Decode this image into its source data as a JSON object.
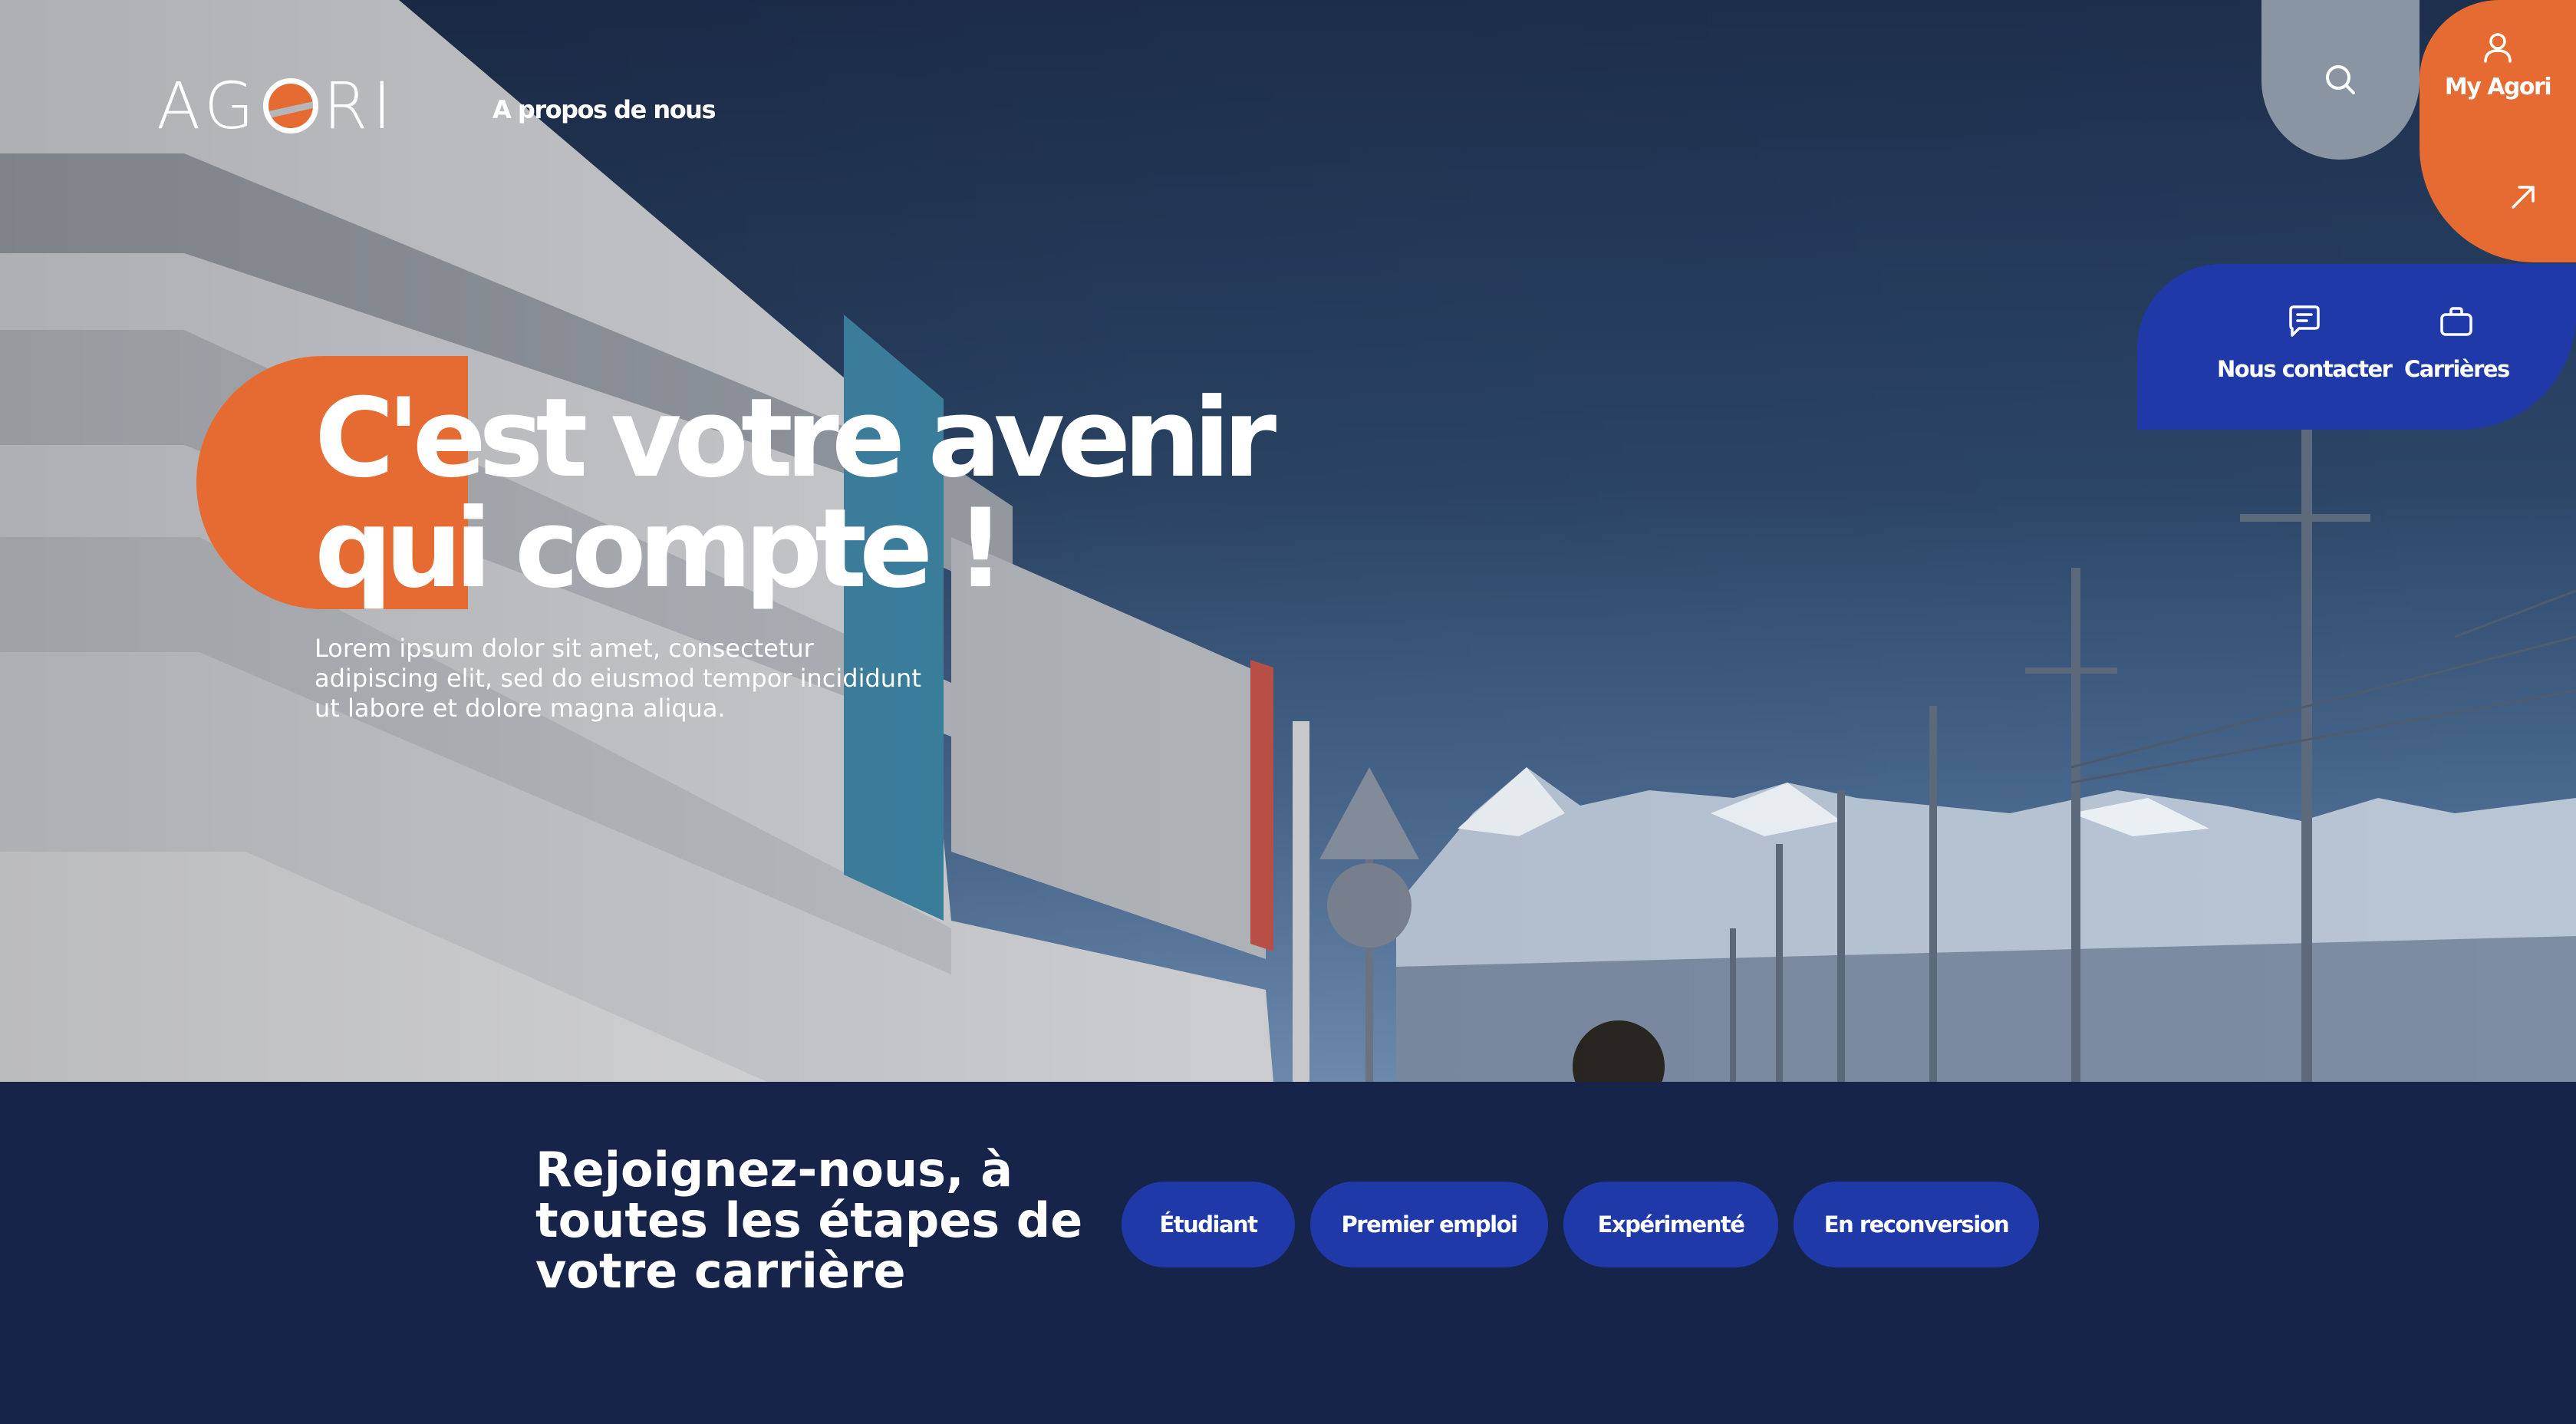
{
  "header": {
    "logo_text": "AGORI",
    "nav_about": "A propos de nous",
    "search_icon": "search-icon",
    "my_agori_label": "My Agori",
    "contact_label": "Nous contacter",
    "careers_label": "Carrières"
  },
  "hero": {
    "headline_line1": "C'est votre avenir",
    "headline_line2": "qui compte !",
    "lead": "Lorem ipsum dolor sit amet, consectetur adipiscing elit, sed do eiusmod tempor incididunt ut labore et dolore magna aliqua."
  },
  "band": {
    "title": "Rejoignez-nous, à toutes les étapes de votre carrière",
    "buttons": [
      "Étudiant",
      "Premier emploi",
      "Expérimenté",
      "En reconversion"
    ]
  },
  "colors": {
    "orange": "#e66b33",
    "blue": "#1f3aa8",
    "navy": "#17244a",
    "grey": "#8a95a3"
  }
}
